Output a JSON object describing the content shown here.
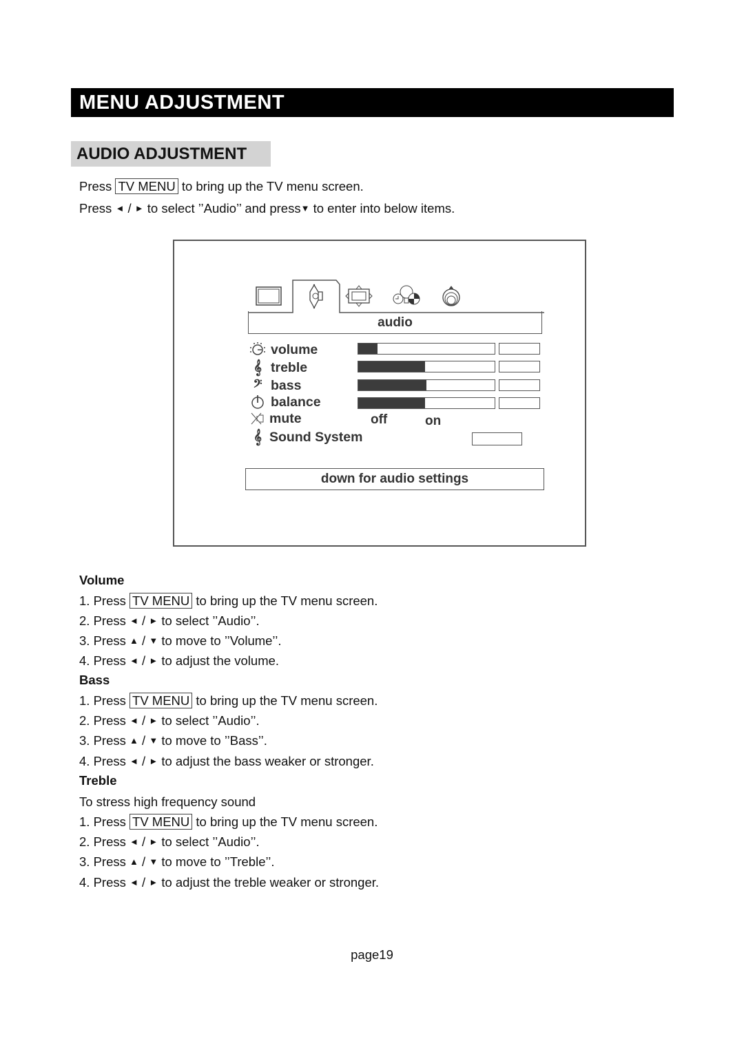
{
  "header": {
    "title": "MENU ADJUSTMENT"
  },
  "section": {
    "title": "AUDIO ADJUSTMENT"
  },
  "intro": {
    "line1": {
      "pre": "Press",
      "key": "TV MENU",
      "post": "to bring up the TV menu screen."
    },
    "line2": {
      "pre": "Press",
      "left": "◄",
      "sep": "/",
      "right": "►",
      "mid": "to select ’’Audio’’ and press",
      "down": "▼",
      "post": "to enter into below items."
    }
  },
  "osd": {
    "tabs": [
      {
        "name": "picture",
        "icon": "tv-screen-icon",
        "active": false
      },
      {
        "name": "audio",
        "icon": "speaker-icon",
        "active": true
      },
      {
        "name": "screen",
        "icon": "screen-adjust-icon",
        "active": false
      },
      {
        "name": "features",
        "icon": "clock-bulb-globe-icon",
        "active": false
      },
      {
        "name": "setup",
        "icon": "dial-icon",
        "active": false
      }
    ],
    "title": "audio",
    "items": [
      {
        "label": "volume",
        "icon": "volume-knob-icon",
        "level": 0.14
      },
      {
        "label": "treble",
        "icon": "treble-clef-icon",
        "level": 0.49
      },
      {
        "label": "bass",
        "icon": "bass-clef-icon",
        "level": 0.5
      },
      {
        "label": "balance",
        "icon": "balance-icon",
        "level": 0.49
      }
    ],
    "mute": {
      "label": "mute",
      "icon": "mute-icon",
      "off": "off",
      "on": "on"
    },
    "sound_system": {
      "label": "Sound System",
      "icon": "treble-clef-icon"
    },
    "hint": "down for audio settings"
  },
  "sections": [
    {
      "title": "Volume",
      "note": null,
      "steps": [
        {
          "num": "1.",
          "pre": "Press",
          "key": "TV MENU",
          "post": "to bring up the TV menu screen."
        },
        {
          "num": "2.",
          "pre": "Press",
          "a1": "◄",
          "sep": "/",
          "a2": "►",
          "post": "to select ’’Audio’’."
        },
        {
          "num": "3.",
          "pre": "Press",
          "a1": "▲",
          "sep": "/",
          "a2": "▼",
          "post": "to move to ’’Volume’’."
        },
        {
          "num": "4.",
          "pre": "Press",
          "a1": "◄",
          "sep": "/",
          "a2": "►",
          "post": "to adjust the volume."
        }
      ]
    },
    {
      "title": "Bass",
      "steps": [
        {
          "num": "1.",
          "pre": "Press",
          "key": "TV MENU",
          "post": "to bring up the TV menu screen."
        },
        {
          "num": "2.",
          "pre": "Press",
          "a1": "◄",
          "sep": "/",
          "a2": "►",
          "post": "to select ’’Audio’’."
        },
        {
          "num": "3.",
          "pre": "Press",
          "a1": "▲",
          "sep": "/",
          "a2": "▼",
          "post": "to move to ’’Bass’’."
        },
        {
          "num": "4.",
          "pre": "Press",
          "a1": "◄",
          "sep": "/",
          "a2": "►",
          "post": "to adjust the bass weaker or stronger."
        }
      ]
    },
    {
      "title": "Treble",
      "note": "To stress high frequency sound",
      "steps": [
        {
          "num": "1.",
          "pre": "Press",
          "key": "TV MENU",
          "post": "to bring up the TV menu screen."
        },
        {
          "num": "2.",
          "pre": "Press",
          "a1": "◄",
          "sep": "/",
          "a2": "►",
          "post": "to select ’’Audio’’."
        },
        {
          "num": "3.",
          "pre": "Press",
          "a1": "▲",
          "sep": "/",
          "a2": "▼",
          "post": "to move to ’’Treble’’."
        },
        {
          "num": "4.",
          "pre": "Press",
          "a1": "◄",
          "sep": "/",
          "a2": "►",
          "post": "to adjust the treble weaker or stronger."
        }
      ]
    }
  ],
  "footer": {
    "page": "page19"
  }
}
